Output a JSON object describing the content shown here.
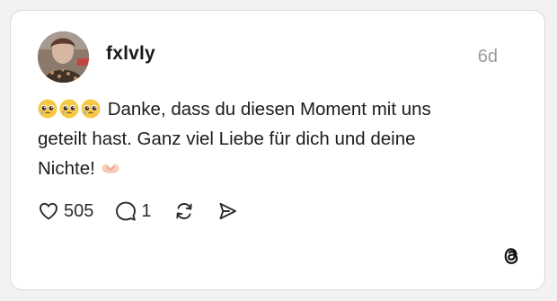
{
  "post": {
    "username": "fxlvly",
    "time": "6d",
    "text_line1_emojis": [
      "pleading-face-emoji",
      "pleading-face-emoji",
      "pleading-face-emoji"
    ],
    "text_line1": " Danke, dass du diesen Moment mit uns",
    "text_line2": "geteilt hast. Ganz viel Liebe für dich und deine",
    "text_line3": "Nichte! ",
    "text_line3_emoji": "heart-hands-emoji"
  },
  "actions": {
    "like_icon": "heart-icon",
    "like_count": "505",
    "comment_icon": "comment-icon",
    "comment_count": "1",
    "repost_icon": "repost-icon",
    "share_icon": "send-icon"
  },
  "brand": {
    "logo_icon": "threads-logo-icon"
  },
  "colors": {
    "text": "#1c1c1c",
    "muted": "#9a9a9a",
    "card_border": "#d9d9d9",
    "background": "#f2f2f2"
  }
}
